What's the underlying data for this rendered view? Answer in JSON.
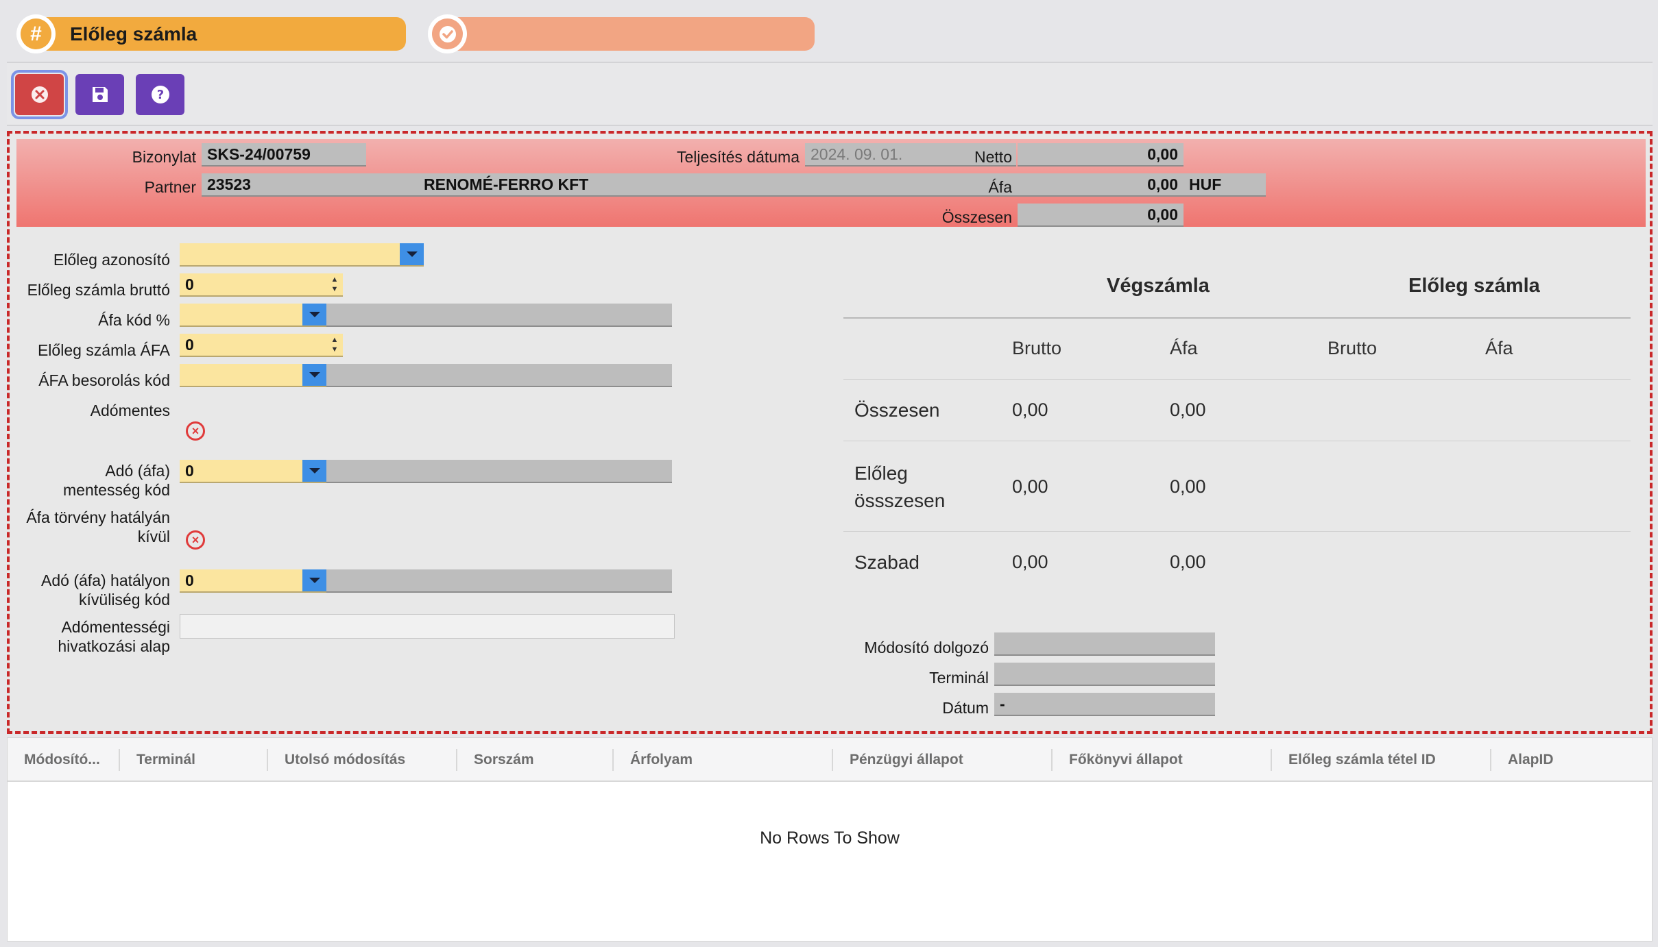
{
  "tabs": [
    {
      "title": "Előleg számla",
      "icon": "hash-icon"
    },
    {
      "title": "",
      "icon": "check-badge-icon"
    }
  ],
  "toolbar": {
    "buttons": [
      {
        "name": "close-button",
        "icon": "close-circle-icon"
      },
      {
        "name": "save-button",
        "icon": "floppy-disk-icon"
      },
      {
        "name": "help-button",
        "icon": "question-circle-icon"
      }
    ]
  },
  "header": {
    "bizonylat_label": "Bizonylat",
    "bizonylat_value": "SKS-24/00759",
    "partner_label": "Partner",
    "partner_code": "23523",
    "partner_name": "RENOMÉ-FERRO KFT",
    "teljesites_label": "Teljesítés dátuma",
    "teljesites_value": "2024. 09. 01.",
    "netto_label": "Netto",
    "netto_value": "0,00",
    "afa_label": "Áfa",
    "afa_value": "0,00",
    "currency": "HUF",
    "osszesen_label": "Összesen",
    "osszesen_value": "0,00"
  },
  "form": {
    "eloleg_azonosito_label": "Előleg azonosító",
    "eloleg_brutto_label": "Előleg számla bruttó",
    "eloleg_brutto_value": "0",
    "afa_kod_label": "Áfa kód %",
    "eloleg_afa_label": "Előleg számla ÁFA",
    "eloleg_afa_value": "0",
    "afa_besorolas_label": "ÁFA besorolás kód",
    "adomentes_label": "Adómentes",
    "mentesseg_label_1": "Adó (áfa)",
    "mentesseg_label_2": "mentesség kód",
    "mentesseg_value": "0",
    "torveny_label_1": "Áfa törvény hatályán",
    "torveny_label_2": "kívül",
    "hatalyon_label_1": "Adó (áfa) hatályon",
    "hatalyon_label_2": "kívüliség kód",
    "hatalyon_value": "0",
    "hivatkozasi_label_1": "Adómentességi",
    "hivatkozasi_label_2": "hivatkozási alap"
  },
  "summary": {
    "vegszamla_title": "Végszámla",
    "eloleg_title": "Előleg számla",
    "col_brutto": "Brutto",
    "col_afa": "Áfa",
    "rows": [
      {
        "label_1": "Összesen",
        "label_2": "",
        "brutto": "0,00",
        "afa": "0,00"
      },
      {
        "label_1": "Előleg",
        "label_2": "össszesen",
        "brutto": "0,00",
        "afa": "0,00"
      },
      {
        "label_1": "Szabad",
        "label_2": "",
        "brutto": "0,00",
        "afa": "0,00"
      }
    ],
    "modosito_label": "Módosító dolgozó",
    "terminal_label": "Terminál",
    "datum_label": "Dátum",
    "datum_value": "-"
  },
  "grid": {
    "columns": [
      "Módosító...",
      "Terminál",
      "Utolsó módosítás",
      "Sorszám",
      "Árfolyam",
      "Pénzügyi állapot",
      "Főkönyvi állapot",
      "Előleg számla tétel ID",
      "AlapID"
    ],
    "empty_text": "No Rows To Show"
  },
  "colors": {
    "tab1": "#f2aa3e",
    "tab2": "#f2a583",
    "close": "#d04545",
    "action": "#6a3fb6",
    "frame_border": "#c9282a",
    "input_yellow": "#fbe59f",
    "dropdown": "#3e8fe5"
  }
}
